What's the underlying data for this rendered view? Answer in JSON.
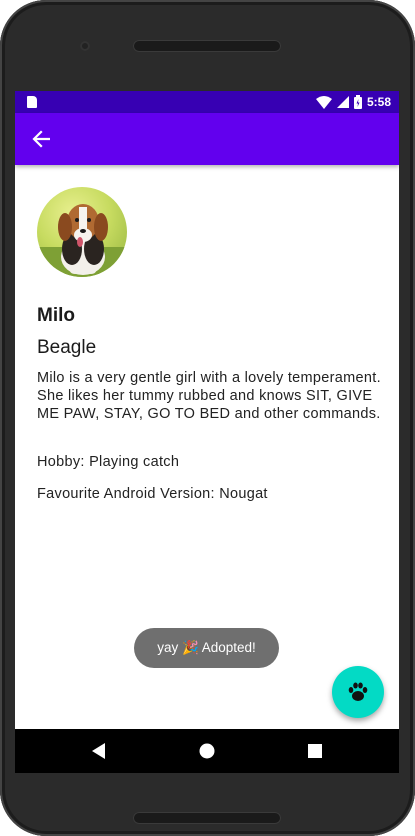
{
  "status_bar": {
    "time": "5:58",
    "icons": [
      "sd-card-icon",
      "wifi-icon",
      "cell-signal-icon",
      "battery-icon"
    ]
  },
  "app_bar": {
    "back_icon": "arrow-back-icon",
    "color": "#6200ee",
    "status_color": "#3700b3"
  },
  "pet": {
    "photo": "beagle-photo",
    "name": "Milo",
    "breed": "Beagle",
    "description": "Milo is a very gentle girl with a lovely temperament. She likes her tummy rubbed and knows SIT, GIVE ME PAW, STAY, GO TO BED and other commands.",
    "hobby": "Hobby: Playing catch",
    "favourite_version": "Favourite Android Version: Nougat"
  },
  "toast": {
    "text": "yay 🎉 Adopted!"
  },
  "fab": {
    "icon": "paw-icon",
    "color": "#03dac5"
  },
  "nav_bar": {
    "buttons": [
      "back-triangle-icon",
      "home-circle-icon",
      "recents-square-icon"
    ]
  }
}
